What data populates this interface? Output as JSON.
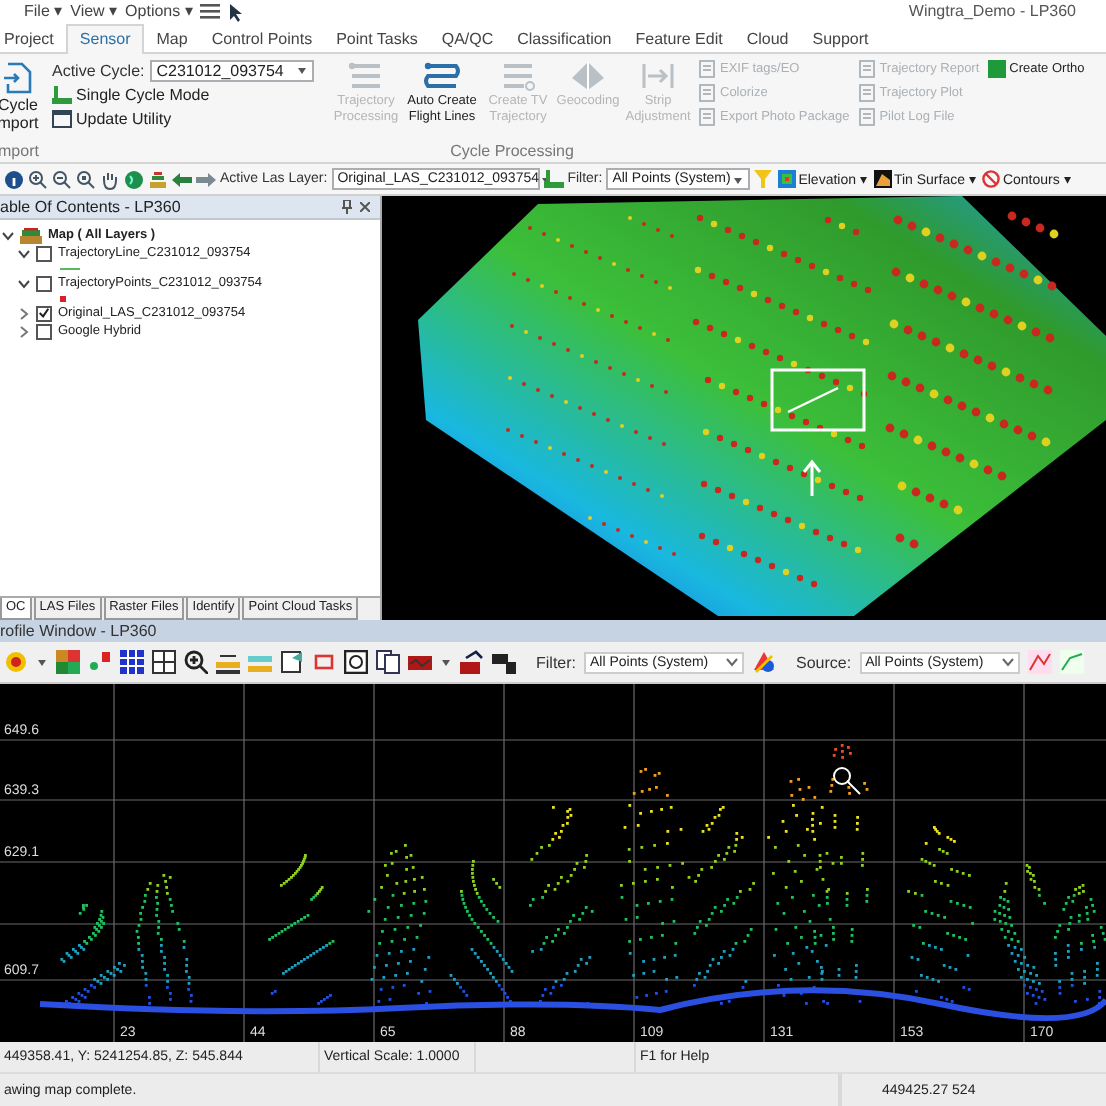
{
  "window": {
    "title": "Wingtra_Demo - LP360",
    "menu": [
      "File ▾",
      "View ▾",
      "Options ▾"
    ]
  },
  "tabs": [
    {
      "label": "Project",
      "selected": false
    },
    {
      "label": "Sensor",
      "selected": true
    },
    {
      "label": "Map",
      "selected": false
    },
    {
      "label": "Control Points",
      "selected": false
    },
    {
      "label": "Point Tasks",
      "selected": false
    },
    {
      "label": "QA/QC",
      "selected": false
    },
    {
      "label": "Classification",
      "selected": false
    },
    {
      "label": "Feature Edit",
      "selected": false
    },
    {
      "label": "Cloud",
      "selected": false
    },
    {
      "label": "Support",
      "selected": false
    }
  ],
  "ribbon": {
    "import_group": {
      "button": "Cycle mport",
      "label": "mport"
    },
    "active_cycle": {
      "label": "Active Cycle:",
      "value": "C231012_093754"
    },
    "cycle_options": [
      {
        "label": "Single Cycle Mode"
      },
      {
        "label": "Update Utility"
      }
    ],
    "large_buttons": [
      {
        "label": "Trajectory Processing",
        "disabled": true
      },
      {
        "label": "Auto Create Flight Lines",
        "disabled": false
      },
      {
        "label": "Create TV Trajectory",
        "disabled": true
      },
      {
        "label": "Geocoding",
        "disabled": true
      },
      {
        "label": "Strip Adjustment",
        "disabled": true
      }
    ],
    "group_label": "Cycle Processing",
    "small_columns": [
      {
        "items": [
          {
            "label": "EXIF tags/EO",
            "disabled": true
          },
          {
            "label": "Colorize",
            "disabled": true
          },
          {
            "label": "Export Photo Package",
            "disabled": true
          }
        ]
      },
      {
        "items": [
          {
            "label": "Trajectory Report",
            "disabled": true
          },
          {
            "label": "Trajectory Plot",
            "disabled": true
          },
          {
            "label": "Pilot Log File",
            "disabled": true
          }
        ]
      },
      {
        "items": [
          {
            "label": "Create Ortho",
            "disabled": false
          }
        ]
      }
    ]
  },
  "toolbar": {
    "active_layer": {
      "label": "Active Las Layer:",
      "value": "Original_LAS_C231012_093754"
    },
    "filter": {
      "label": "Filter:",
      "value": "All Points (System)"
    },
    "menus": [
      {
        "label": "Elevation ▾"
      },
      {
        "label": "Tin Surface ▾"
      },
      {
        "label": "Contours ▾"
      }
    ]
  },
  "toc": {
    "title": "able Of Contents - LP360",
    "tree": [
      {
        "label": "Map ( All Layers )",
        "expanded": true,
        "children": [
          {
            "label": "TrajectoryLine_C231012_093754",
            "checked": false,
            "expanded": true,
            "legend": {
              "kind": "line",
              "color": "#5cb85c"
            }
          },
          {
            "label": "TrajectoryPoints_C231012_093754",
            "checked": false,
            "expanded": true,
            "legend": {
              "kind": "point",
              "color": "#d9202a"
            }
          },
          {
            "label": "Original_LAS_C231012_093754",
            "checked": true,
            "expanded": false
          },
          {
            "label": "Google Hybrid",
            "checked": false,
            "expanded": false
          }
        ]
      }
    ],
    "tabs": [
      {
        "label": "OC",
        "selected": true
      },
      {
        "label": "LAS Files",
        "selected": false
      },
      {
        "label": "Raster Files",
        "selected": false
      },
      {
        "label": "Identify",
        "selected": false
      },
      {
        "label": "Point Cloud Tasks",
        "selected": false
      }
    ]
  },
  "profile": {
    "title": "rofile Window - LP360",
    "filter": {
      "label": "Filter:",
      "value": "All Points (System)"
    },
    "source": {
      "label": "Source:",
      "value": "All Points (System)"
    },
    "y_labels": [
      "649.6",
      "639.3",
      "629.1",
      "609.7"
    ],
    "x_labels": [
      "23",
      "44",
      "65",
      "88",
      "109",
      "131",
      "153",
      "170"
    ]
  },
  "status": {
    "coords": "449358.41, Y: 5241254.85, Z: 545.844",
    "vertical_scale": "Vertical Scale: 1.0000",
    "help": "F1 for Help",
    "message": "awing map complete.",
    "coords_right": "449425.27 524"
  }
}
